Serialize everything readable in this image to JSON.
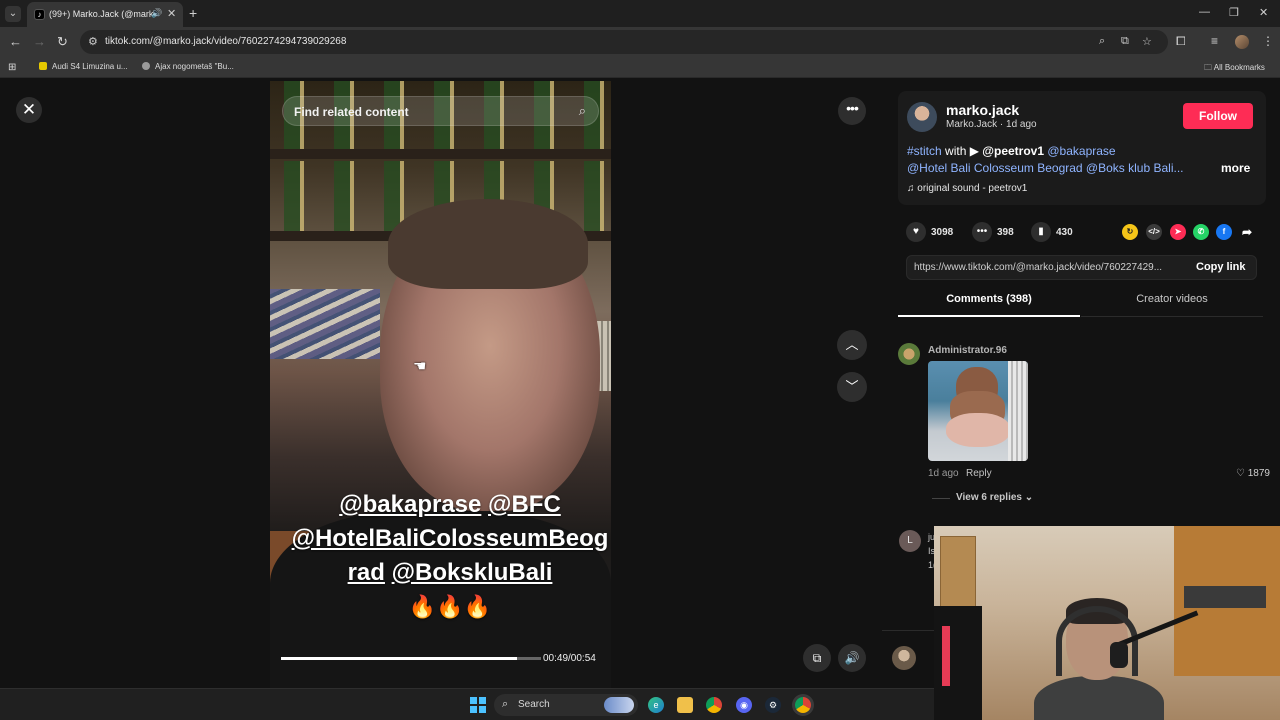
{
  "browser": {
    "tab": {
      "title": "(99+) Marko.Jack (@marko.j",
      "favicon": "tiktok-icon",
      "audio_icon": "speaker-icon"
    },
    "address": "tiktok.com/@marko.jack/video/7602274294739029268",
    "bookmarks": [
      {
        "label": "Audi S4 Limuzina u...",
        "color": "#e6c800"
      },
      {
        "label": "Ajax nogometaš \"Bu...",
        "color": "#9a9a9a"
      }
    ],
    "all_bookmarks": "All Bookmarks"
  },
  "video": {
    "search_placeholder": "Find related content",
    "caption": {
      "line1a": "@bakaprase",
      "line1b": "@BFC",
      "line2": "@HotelBaliColosseumBeog",
      "line3a": "rad",
      "line3b": "@BokskluBali",
      "emoji": "🔥🔥🔥"
    },
    "time": "00:49/00:54",
    "progress": 0.907
  },
  "author": {
    "name": "marko.jack",
    "sub": "Marko.Jack · 1d ago",
    "follow": "Follow",
    "desc_hashtag": "#stitch",
    "desc_with": "with",
    "desc_mention_bold": "@peetrov1",
    "desc_mention": "@bakaprase",
    "desc_line2": "@Hotel Bali Colosseum Beograd @Boks klub Bali...",
    "more": "more",
    "music": "original sound - peetrov1"
  },
  "stats": {
    "likes": "3098",
    "comments": "398",
    "saves": "430"
  },
  "share": {
    "url": "https://www.tiktok.com/@marko.jack/video/760227429...",
    "copy": "Copy link"
  },
  "tabs": {
    "comments": "Comments (398)",
    "creator": "Creator videos"
  },
  "comments": [
    {
      "user": "Administrator.96",
      "time": "1d ago",
      "reply": "Reply",
      "likes": "1879",
      "view_replies": "View 6 replies"
    },
    {
      "avatar_letter": "L",
      "frag1": "ju",
      "frag2": "Is",
      "frag3": "1("
    }
  ],
  "taskbar": {
    "search": "Search",
    "apps": [
      "edge-icon",
      "file-explorer-icon",
      "chrome-icon",
      "discord-icon",
      "steam-icon",
      "chrome-active-icon"
    ]
  },
  "colors": {
    "follow": "#fe2c55",
    "link": "#8fb4ff",
    "windows_accent": "#4cc2ff"
  }
}
